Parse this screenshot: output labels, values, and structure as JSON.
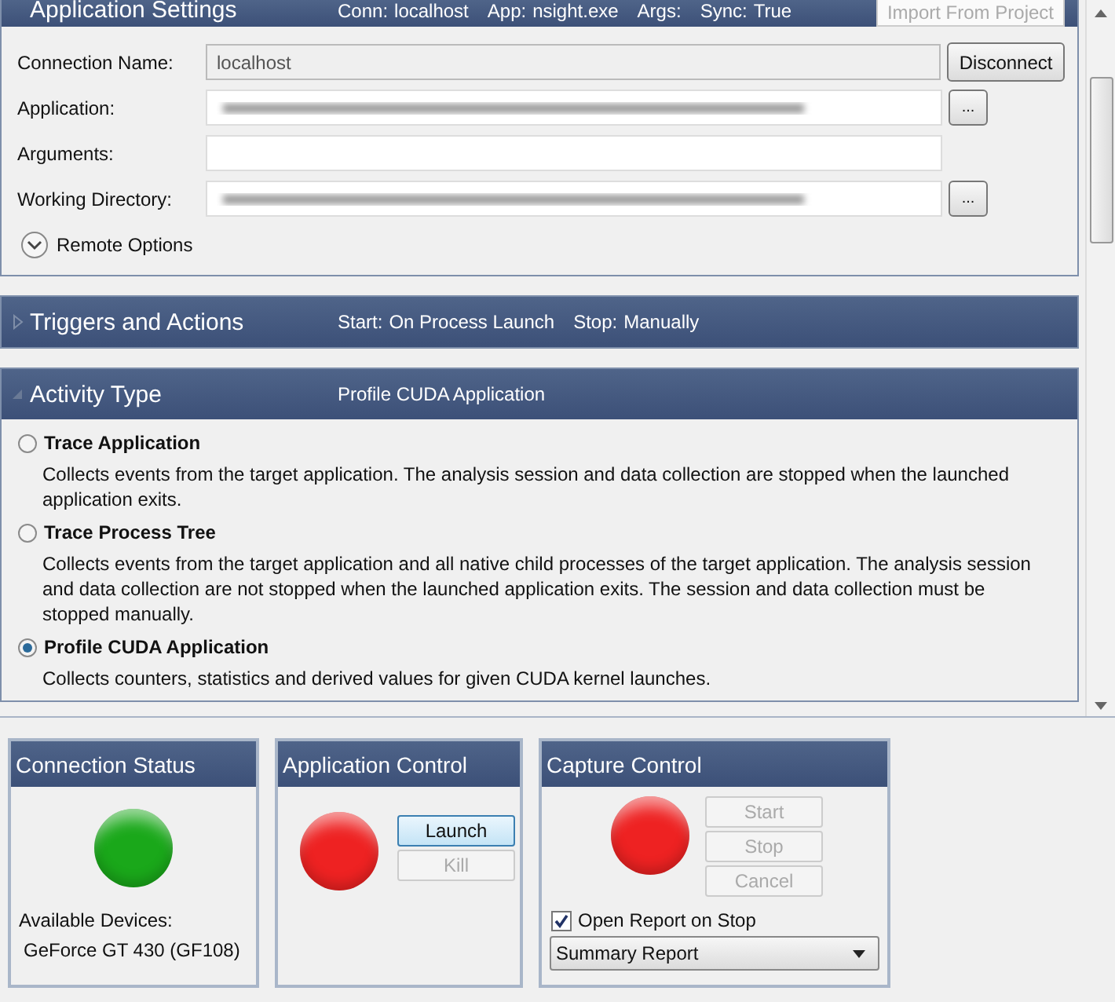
{
  "settings": {
    "title": "Application Settings",
    "summary": [
      {
        "label": "Conn:",
        "value": "localhost"
      },
      {
        "label": "App:",
        "value": "nsight.exe"
      },
      {
        "label": "Args:"
      },
      {
        "label": "Sync:",
        "value": "True"
      }
    ],
    "import_button": {
      "label": "Import From Project",
      "disabled": true
    },
    "fields": [
      {
        "label": "Connection Name:",
        "kind": "readonly",
        "value": "localhost",
        "button": "Disconnect"
      },
      {
        "label": "Application:",
        "kind": "redacted",
        "button": "..."
      },
      {
        "label": "Arguments:",
        "kind": "text"
      },
      {
        "label": "Working Directory:",
        "kind": "redacted",
        "button": "..."
      }
    ],
    "remote_options": {
      "label": "Remote Options",
      "expanded": false
    }
  },
  "triggers": {
    "title": "Triggers and Actions",
    "expanded": false,
    "summary": [
      {
        "label": "Start:",
        "value": "On Process Launch"
      },
      {
        "label": "Stop:",
        "value": "Manually"
      }
    ]
  },
  "activity": {
    "title": "Activity Type",
    "expanded": true,
    "summary": "Profile CUDA Application",
    "options": [
      {
        "label": "Trace Application",
        "description": "Collects events from the target application. The analysis session and data collection are stopped when the launched application exits.",
        "selected": false
      },
      {
        "label": "Trace Process Tree",
        "description": "Collects events from the target application and all native child processes of the target application. The analysis session and data collection are not stopped when the launched application exits. The session and data collection must be stopped manually.",
        "selected": false
      },
      {
        "label": "Profile CUDA Application",
        "description": "Collects counters, statistics and derived values for given CUDA kernel launches.",
        "selected": true
      }
    ]
  },
  "panels": [
    {
      "kind": "connection",
      "title": "Connection Status",
      "color": "#1aa81a",
      "devices_label": "Available Devices:",
      "devices": [
        "GeForce GT 430 (GF108)"
      ]
    },
    {
      "kind": "application",
      "title": "Application Control",
      "color": "#ee2222",
      "buttons": [
        {
          "label": "Launch",
          "disabled": false,
          "focused": true
        },
        {
          "label": "Kill",
          "disabled": true,
          "focused": false
        }
      ]
    },
    {
      "kind": "capture",
      "title": "Capture Control",
      "color": "#ee2222",
      "buttons": [
        {
          "label": "Start",
          "disabled": true,
          "focused": false
        },
        {
          "label": "Stop",
          "disabled": true,
          "focused": false
        },
        {
          "label": "Cancel",
          "disabled": true,
          "focused": false
        }
      ],
      "open_report": {
        "label": "Open Report on Stop",
        "checked": true
      },
      "report": {
        "value": "Summary Report"
      }
    }
  ]
}
